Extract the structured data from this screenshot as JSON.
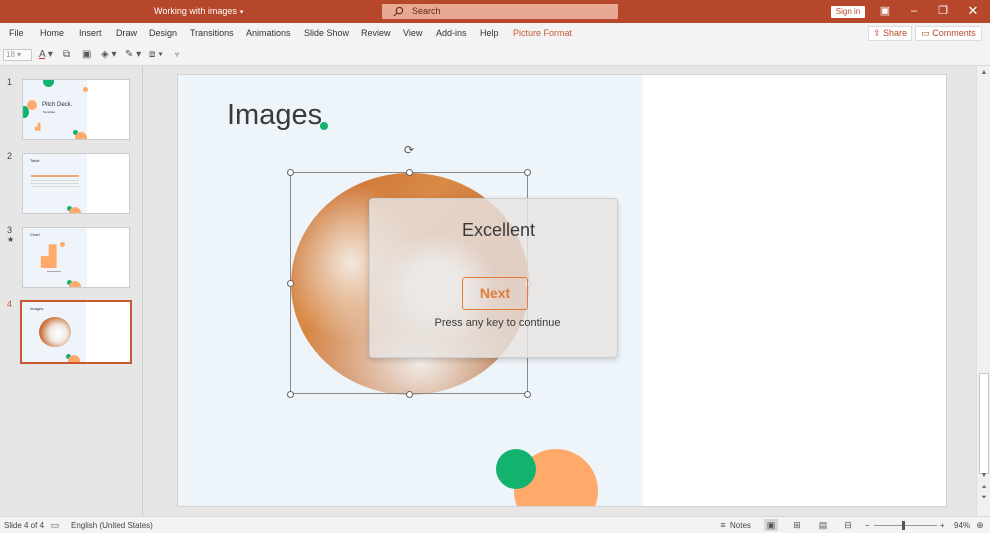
{
  "window": {
    "title": "Working with images",
    "search_placeholder": "Search",
    "sign_in": "Sign in"
  },
  "ribbon": {
    "tabs": [
      "File",
      "Home",
      "Insert",
      "Draw",
      "Design",
      "Transitions",
      "Animations",
      "Slide Show",
      "Review",
      "View",
      "Add-ins",
      "Help",
      "Picture Format"
    ],
    "active_tab": "Picture Format",
    "share": "Share",
    "comments": "Comments"
  },
  "toolbar": {
    "font_size": "18"
  },
  "thumbnails": [
    {
      "number": "1",
      "title": "Pitch Deck.",
      "subtitle": "Template"
    },
    {
      "number": "2",
      "title": "Table."
    },
    {
      "number": "3",
      "title": "Chart."
    },
    {
      "number": "4",
      "title": "Images."
    }
  ],
  "slide": {
    "title": "Images"
  },
  "overlay": {
    "title": "Excellent",
    "button": "Next",
    "hint": "Press any key to continue"
  },
  "status": {
    "slide_info": "Slide 4 of 4",
    "language": "English (United States)",
    "notes": "Notes",
    "zoom": "94%"
  },
  "colors": {
    "accent": "#b7472a",
    "ribbon_active": "#c55a32",
    "green": "#13b26f",
    "orange": "#ffaa6a"
  }
}
